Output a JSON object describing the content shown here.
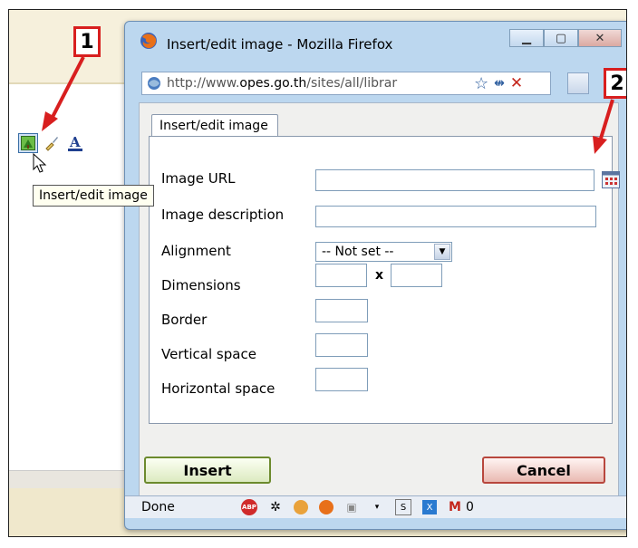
{
  "callouts": {
    "one": "1",
    "two": "2"
  },
  "editor": {
    "tooltip": "Insert/edit image"
  },
  "window": {
    "title": "Insert/edit image - Mozilla Firefox",
    "url_prefix": "http://www.",
    "url_domain": "opes.go.th",
    "url_suffix": "/sites/all/librar",
    "tab_label": "Insert/edit image",
    "status": "Done",
    "mail_count": "0"
  },
  "form": {
    "image_url_label": "Image URL",
    "image_description_label": "Image description",
    "alignment_label": "Alignment",
    "alignment_value": "-- Not set --",
    "dimensions_label": "Dimensions",
    "dimensions_separator": "x",
    "border_label": "Border",
    "vertical_space_label": "Vertical space",
    "horizontal_space_label": "Horizontal space"
  },
  "buttons": {
    "insert": "Insert",
    "cancel": "Cancel"
  },
  "icons": [
    "insert-image-icon",
    "cleanup-icon",
    "text-color-icon",
    "firefox-logo-icon",
    "browse-icon",
    "adblock-icon",
    "gmail-icon"
  ],
  "colors": {
    "callout_red": "#d81f1f",
    "window_frame": "#bcd7ef"
  }
}
